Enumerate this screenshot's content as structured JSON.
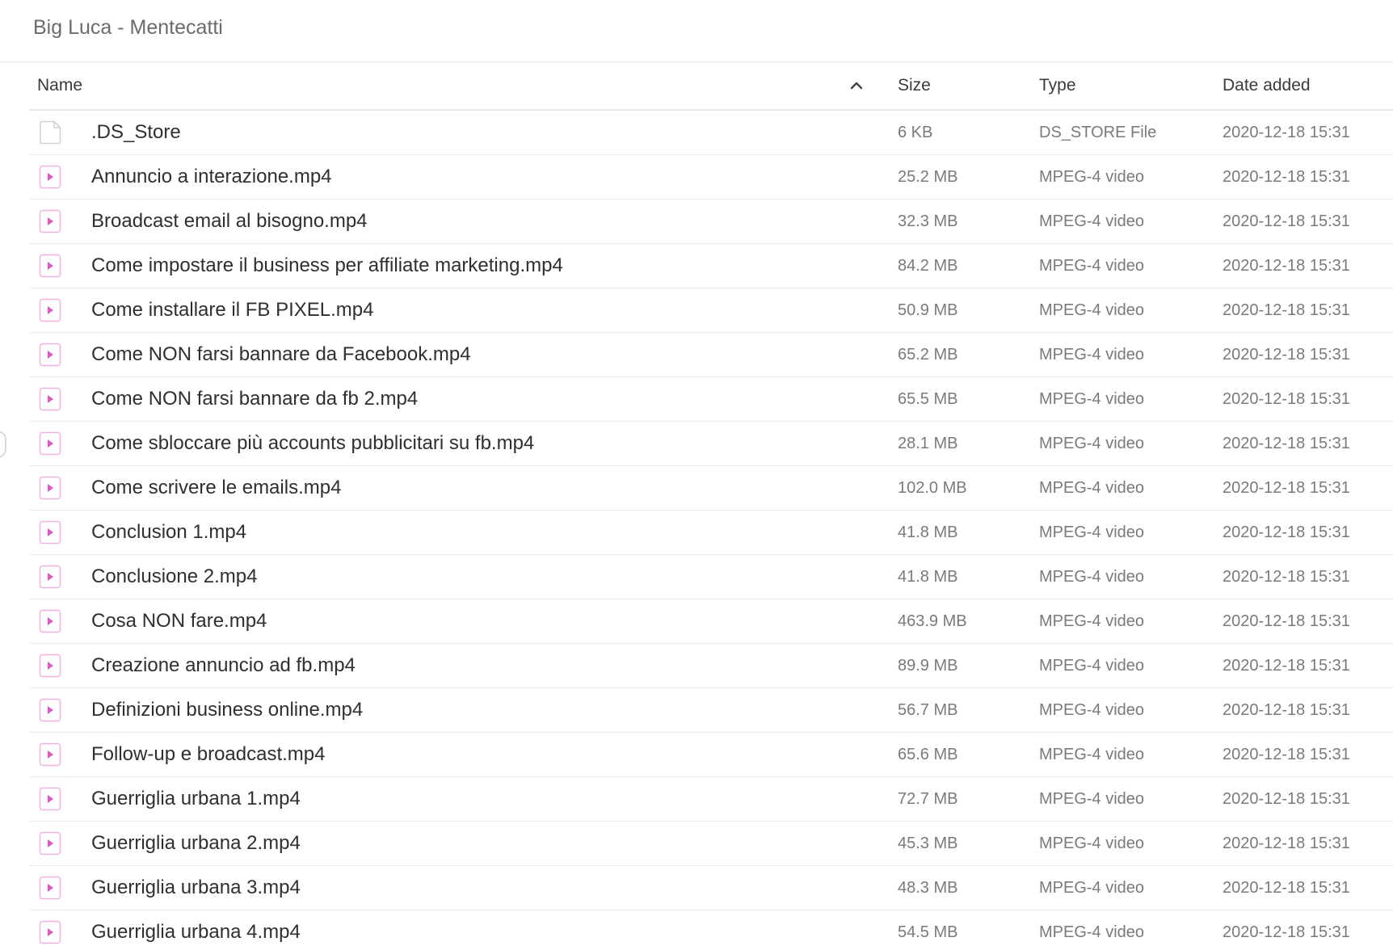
{
  "breadcrumb": {
    "path": "Big Luca - Mentecatti"
  },
  "table": {
    "columns": {
      "name": "Name",
      "size": "Size",
      "type": "Type",
      "date": "Date added"
    },
    "sort": {
      "column": "name",
      "direction": "ascending",
      "icon": "chevron-up-icon"
    },
    "accent_color": "#e455c4",
    "rows": [
      {
        "name": ".DS_Store",
        "size": "6 KB",
        "type": "DS_STORE File",
        "date": "2020-12-18 15:31",
        "icon": "generic-file-icon"
      },
      {
        "name": "Annuncio a interazione.mp4",
        "size": "25.2 MB",
        "type": "MPEG-4 video",
        "date": "2020-12-18 15:31",
        "icon": "video-file-icon"
      },
      {
        "name": "Broadcast email al bisogno.mp4",
        "size": "32.3 MB",
        "type": "MPEG-4 video",
        "date": "2020-12-18 15:31",
        "icon": "video-file-icon"
      },
      {
        "name": "Come impostare il business per affiliate marketing.mp4",
        "size": "84.2 MB",
        "type": "MPEG-4 video",
        "date": "2020-12-18 15:31",
        "icon": "video-file-icon"
      },
      {
        "name": "Come installare il FB PIXEL.mp4",
        "size": "50.9 MB",
        "type": "MPEG-4 video",
        "date": "2020-12-18 15:31",
        "icon": "video-file-icon"
      },
      {
        "name": "Come NON farsi bannare da Facebook.mp4",
        "size": "65.2 MB",
        "type": "MPEG-4 video",
        "date": "2020-12-18 15:31",
        "icon": "video-file-icon"
      },
      {
        "name": "Come NON farsi bannare da fb 2.mp4",
        "size": "65.5 MB",
        "type": "MPEG-4 video",
        "date": "2020-12-18 15:31",
        "icon": "video-file-icon"
      },
      {
        "name": "Come sbloccare più accounts pubblicitari su fb.mp4",
        "size": "28.1 MB",
        "type": "MPEG-4 video",
        "date": "2020-12-18 15:31",
        "icon": "video-file-icon"
      },
      {
        "name": "Come scrivere le emails.mp4",
        "size": "102.0 MB",
        "type": "MPEG-4 video",
        "date": "2020-12-18 15:31",
        "icon": "video-file-icon"
      },
      {
        "name": "Conclusion 1.mp4",
        "size": "41.8 MB",
        "type": "MPEG-4 video",
        "date": "2020-12-18 15:31",
        "icon": "video-file-icon"
      },
      {
        "name": "Conclusione 2.mp4",
        "size": "41.8 MB",
        "type": "MPEG-4 video",
        "date": "2020-12-18 15:31",
        "icon": "video-file-icon"
      },
      {
        "name": "Cosa NON fare.mp4",
        "size": "463.9 MB",
        "type": "MPEG-4 video",
        "date": "2020-12-18 15:31",
        "icon": "video-file-icon"
      },
      {
        "name": "Creazione annuncio ad fb.mp4",
        "size": "89.9 MB",
        "type": "MPEG-4 video",
        "date": "2020-12-18 15:31",
        "icon": "video-file-icon"
      },
      {
        "name": "Definizioni business online.mp4",
        "size": "56.7 MB",
        "type": "MPEG-4 video",
        "date": "2020-12-18 15:31",
        "icon": "video-file-icon"
      },
      {
        "name": "Follow-up e broadcast.mp4",
        "size": "65.6 MB",
        "type": "MPEG-4 video",
        "date": "2020-12-18 15:31",
        "icon": "video-file-icon"
      },
      {
        "name": "Guerriglia urbana 1.mp4",
        "size": "72.7 MB",
        "type": "MPEG-4 video",
        "date": "2020-12-18 15:31",
        "icon": "video-file-icon"
      },
      {
        "name": "Guerriglia urbana 2.mp4",
        "size": "45.3 MB",
        "type": "MPEG-4 video",
        "date": "2020-12-18 15:31",
        "icon": "video-file-icon"
      },
      {
        "name": "Guerriglia urbana 3.mp4",
        "size": "48.3 MB",
        "type": "MPEG-4 video",
        "date": "2020-12-18 15:31",
        "icon": "video-file-icon"
      },
      {
        "name": "Guerriglia urbana 4.mp4",
        "size": "54.5 MB",
        "type": "MPEG-4 video",
        "date": "2020-12-18 15:31",
        "icon": "video-file-icon"
      }
    ]
  }
}
